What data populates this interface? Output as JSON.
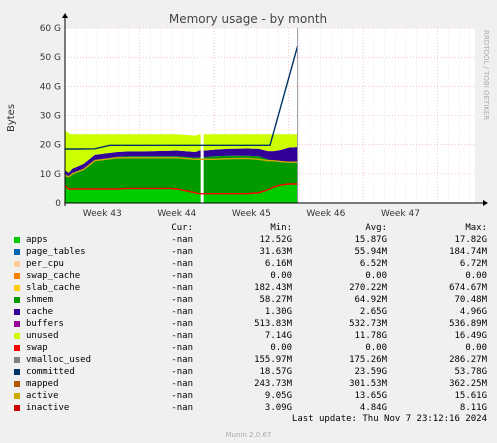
{
  "chart_data": {
    "type": "area",
    "title": "Memory usage - by month",
    "ylabel": "Bytes",
    "y_ticks": [
      "0",
      "10 G",
      "20 G",
      "30 G",
      "40 G",
      "50 G",
      "60 G"
    ],
    "ylim": [
      0,
      60
    ],
    "x_ticks": [
      "Week 43",
      "Week 44",
      "Week 45",
      "Week 46",
      "Week 47"
    ],
    "x_range_weeks": [
      42.0,
      47.5
    ],
    "grid": true,
    "watermark": "RRDTOOL / TOBI OETIKER",
    "gap_week": 43.84,
    "stack_weeks": [
      42.0,
      42.05,
      42.1,
      42.15,
      42.25,
      42.4,
      42.55,
      42.7,
      42.85,
      43.0,
      43.2,
      43.4,
      43.5,
      43.75,
      43.8,
      43.84,
      43.88,
      44.0,
      44.2,
      44.45,
      44.6,
      44.72,
      44.8,
      44.9,
      45.0,
      45.12
    ],
    "series": [
      {
        "name": "apps",
        "color": "#00cc00",
        "values": [
          6.0,
          4.8,
          4.8,
          4.8,
          4.8,
          4.8,
          4.8,
          4.8,
          5.0,
          5.0,
          5.0,
          5.0,
          4.8,
          3.5,
          3.2,
          3.2,
          3.2,
          3.2,
          3.2,
          3.2,
          3.5,
          4.5,
          5.5,
          6.2,
          6.5,
          6.5
        ]
      },
      {
        "name": "shmem",
        "color": "#009900",
        "values": [
          4.0,
          4.2,
          5.5,
          6.0,
          7.0,
          10.0,
          10.5,
          11.0,
          11.0,
          11.0,
          11.0,
          11.0,
          11.2,
          12.0,
          12.5,
          12.5,
          12.5,
          12.8,
          13.0,
          13.0,
          12.5,
          10.5,
          9.0,
          8.0,
          7.5,
          7.5
        ]
      },
      {
        "name": "cache",
        "color": "#330099",
        "values": [
          1.2,
          1.4,
          1.5,
          1.5,
          1.6,
          1.7,
          1.7,
          1.7,
          1.7,
          1.7,
          1.8,
          1.9,
          2.0,
          2.0,
          2.3,
          2.3,
          2.3,
          2.3,
          2.4,
          2.5,
          2.6,
          2.8,
          3.3,
          4.0,
          5.0,
          5.2
        ]
      },
      {
        "name": "unused",
        "color": "#ccff00",
        "values": [
          13.7,
          13.5,
          11.8,
          11.3,
          10.2,
          7.1,
          6.6,
          6.1,
          5.9,
          5.9,
          5.8,
          5.7,
          5.6,
          5.6,
          5.6,
          5.6,
          5.6,
          5.3,
          5.0,
          4.9,
          5.0,
          5.8,
          5.8,
          5.4,
          4.6,
          4.4
        ]
      }
    ],
    "lines": [
      {
        "name": "inactive",
        "color": "#ff0000",
        "values": [
          6.0,
          4.8,
          4.8,
          4.8,
          4.8,
          4.8,
          4.8,
          4.8,
          5.0,
          5.0,
          5.0,
          5.0,
          4.8,
          3.5,
          3.2,
          3.2,
          3.2,
          3.2,
          3.2,
          3.2,
          3.5,
          4.5,
          5.5,
          6.2,
          6.5,
          6.5
        ]
      },
      {
        "name": "active",
        "color": "#ccaa00",
        "values": [
          9.5,
          9.0,
          10.0,
          10.5,
          11.5,
          14.5,
          15.0,
          15.5,
          15.5,
          15.5,
          15.5,
          15.5,
          15.5,
          15.0,
          15.0,
          15.0,
          15.0,
          15.0,
          15.2,
          15.3,
          15.0,
          14.5,
          14.5,
          14.2,
          14.0,
          14.0
        ]
      },
      {
        "name": "committed",
        "color": "#003366",
        "weeks": [
          42.0,
          42.1,
          42.2,
          42.4,
          42.6,
          43.0,
          43.2,
          43.5,
          43.75,
          43.85,
          44.0,
          44.3,
          44.6,
          44.75,
          45.12
        ],
        "values": [
          18.5,
          18.5,
          18.5,
          18.6,
          19.8,
          19.8,
          19.8,
          19.8,
          19.8,
          19.8,
          19.8,
          19.8,
          19.8,
          19.8,
          53.8
        ]
      }
    ]
  },
  "legend": {
    "headers": [
      "Cur:",
      "Min:",
      "Avg:",
      "Max:"
    ],
    "rows": [
      {
        "name": "apps",
        "color": "#00cc00",
        "cur": "-nan",
        "min": "12.52G",
        "avg": "15.87G",
        "max": "17.82G"
      },
      {
        "name": "page_tables",
        "color": "#0066b3",
        "cur": "-nan",
        "min": "31.63M",
        "avg": "55.94M",
        "max": "184.74M"
      },
      {
        "name": "per_cpu",
        "color": "#ffcc99",
        "cur": "-nan",
        "min": "6.16M",
        "avg": "6.52M",
        "max": "6.72M"
      },
      {
        "name": "swap_cache",
        "color": "#ff8000",
        "cur": "-nan",
        "min": "0.00",
        "avg": "0.00",
        "max": "0.00"
      },
      {
        "name": "slab_cache",
        "color": "#ffcc00",
        "cur": "-nan",
        "min": "182.43M",
        "avg": "270.22M",
        "max": "674.67M"
      },
      {
        "name": "shmem",
        "color": "#009900",
        "cur": "-nan",
        "min": "58.27M",
        "avg": "64.92M",
        "max": "70.48M"
      },
      {
        "name": "cache",
        "color": "#330099",
        "cur": "-nan",
        "min": "1.30G",
        "avg": "2.65G",
        "max": "4.96G"
      },
      {
        "name": "buffers",
        "color": "#990099",
        "cur": "-nan",
        "min": "513.83M",
        "avg": "532.73M",
        "max": "536.89M"
      },
      {
        "name": "unused",
        "color": "#ccff00",
        "cur": "-nan",
        "min": "7.14G",
        "avg": "11.78G",
        "max": "16.49G"
      },
      {
        "name": "swap",
        "color": "#ff0000",
        "cur": "-nan",
        "min": "0.00",
        "avg": "0.00",
        "max": "0.00"
      },
      {
        "name": "vmalloc_used",
        "color": "#808080",
        "cur": "-nan",
        "min": "155.97M",
        "avg": "175.26M",
        "max": "286.27M"
      },
      {
        "name": "committed",
        "color": "#003366",
        "cur": "-nan",
        "min": "18.57G",
        "avg": "23.59G",
        "max": "53.78G"
      },
      {
        "name": "mapped",
        "color": "#b35a00",
        "cur": "-nan",
        "min": "243.73M",
        "avg": "301.53M",
        "max": "362.25M"
      },
      {
        "name": "active",
        "color": "#ccaa00",
        "cur": "-nan",
        "min": "9.05G",
        "avg": "13.65G",
        "max": "15.61G"
      },
      {
        "name": "inactive",
        "color": "#cc0000",
        "cur": "-nan",
        "min": "3.09G",
        "avg": "4.84G",
        "max": "8.11G"
      }
    ]
  },
  "last_update": "Last update: Thu Nov  7 23:12:16 2024",
  "footer": "Munin 2.0.67"
}
